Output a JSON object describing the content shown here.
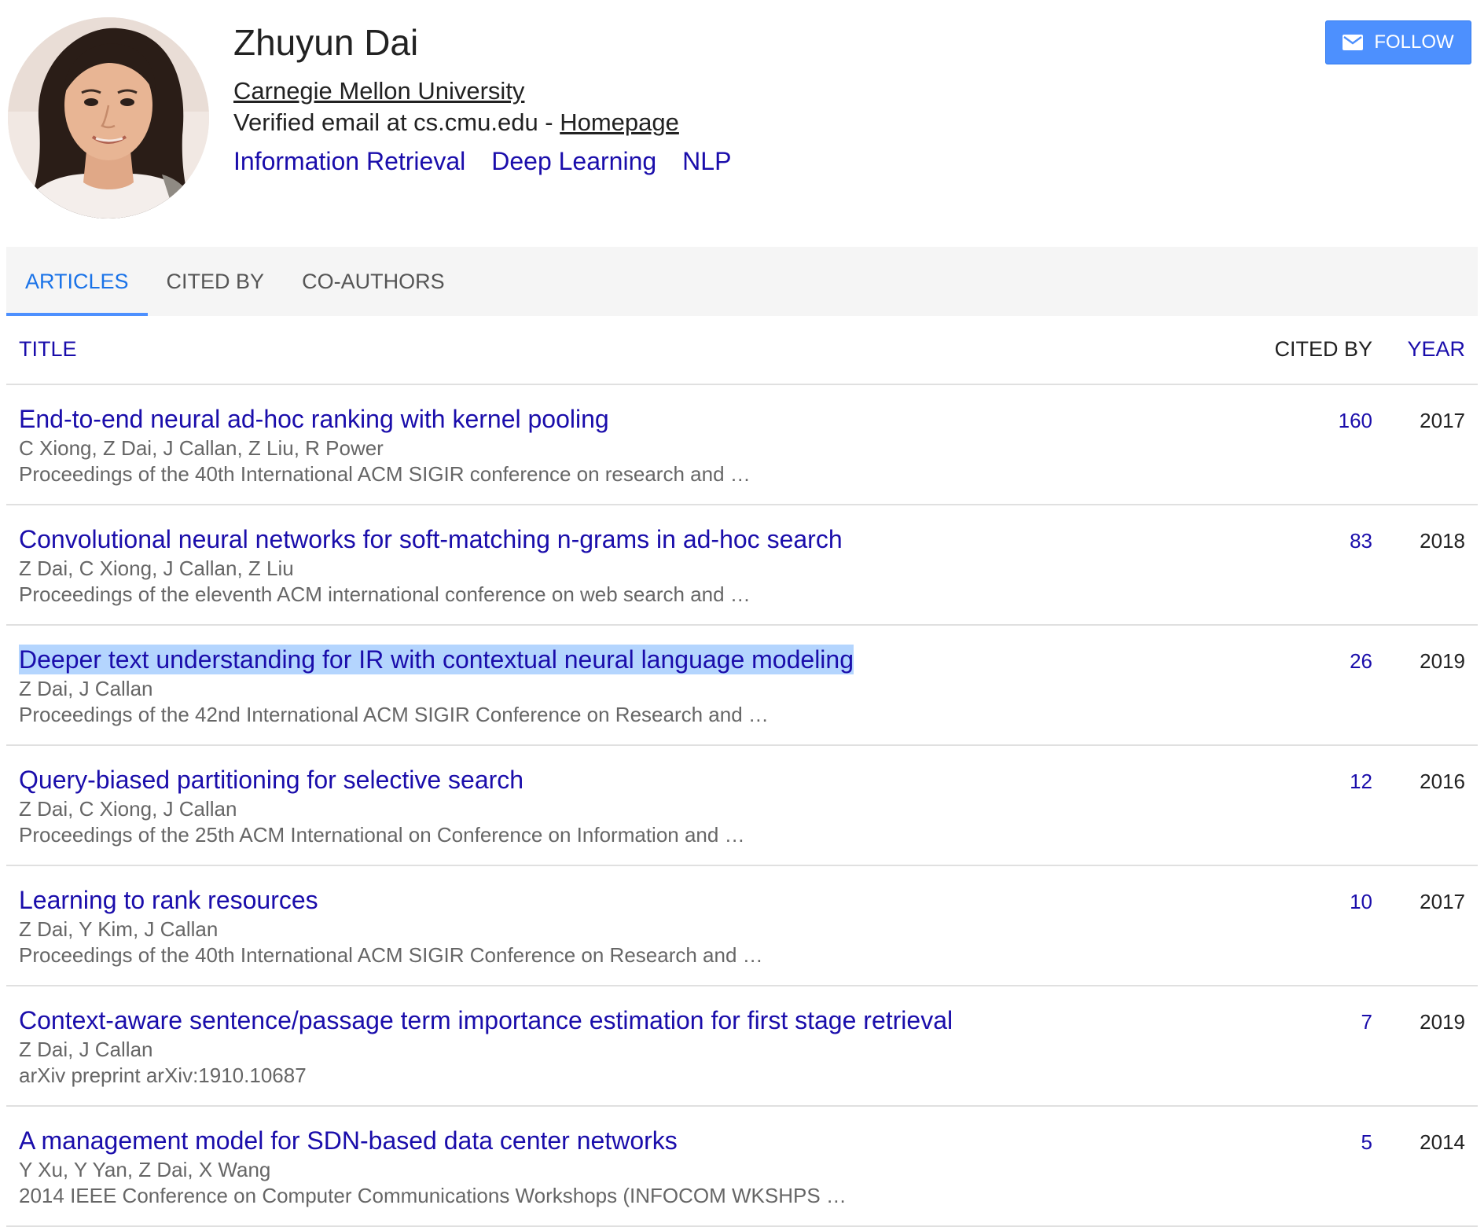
{
  "profile": {
    "name": "Zhuyun Dai",
    "affiliation": "Carnegie Mellon University",
    "email_text": "Verified email at cs.cmu.edu - ",
    "homepage_label": "Homepage",
    "interests": [
      "Information Retrieval",
      "Deep Learning",
      "NLP"
    ],
    "follow_label": "FOLLOW",
    "follow_icon": "envelope-icon",
    "accent_color": "#4d90fe"
  },
  "tabs": [
    {
      "label": "ARTICLES",
      "active": true
    },
    {
      "label": "CITED BY",
      "active": false
    },
    {
      "label": "CO-AUTHORS",
      "active": false
    }
  ],
  "table": {
    "headers": {
      "title": "TITLE",
      "cited_by": "CITED BY",
      "year": "YEAR"
    },
    "rows": [
      {
        "title": "End-to-end neural ad-hoc ranking with kernel pooling",
        "authors": "C Xiong, Z Dai, J Callan, Z Liu, R Power",
        "venue": "Proceedings of the 40th International ACM SIGIR conference on research and …",
        "cited_by": "160",
        "year": "2017"
      },
      {
        "title": "Convolutional neural networks for soft-matching n-grams in ad-hoc search",
        "authors": "Z Dai, C Xiong, J Callan, Z Liu",
        "venue": "Proceedings of the eleventh ACM international conference on web search and …",
        "cited_by": "83",
        "year": "2018"
      },
      {
        "title": "Deeper text understanding for IR with contextual neural language modeling",
        "authors": "Z Dai, J Callan",
        "venue": "Proceedings of the 42nd International ACM SIGIR Conference on Research and …",
        "cited_by": "26",
        "year": "2019",
        "selected": true
      },
      {
        "title": "Query-biased partitioning for selective search",
        "authors": "Z Dai, C Xiong, J Callan",
        "venue": "Proceedings of the 25th ACM International on Conference on Information and …",
        "cited_by": "12",
        "year": "2016"
      },
      {
        "title": "Learning to rank resources",
        "authors": "Z Dai, Y Kim, J Callan",
        "venue": "Proceedings of the 40th International ACM SIGIR Conference on Research and …",
        "cited_by": "10",
        "year": "2017"
      },
      {
        "title": "Context-aware sentence/passage term importance estimation for first stage retrieval",
        "authors": "Z Dai, J Callan",
        "venue": "arXiv preprint arXiv:1910.10687",
        "cited_by": "7",
        "year": "2019"
      },
      {
        "title": "A management model for SDN-based data center networks",
        "authors": "Y Xu, Y Yan, Z Dai, X Wang",
        "venue": "2014 IEEE Conference on Computer Communications Workshops (INFOCOM WKSHPS …",
        "cited_by": "5",
        "year": "2014"
      }
    ]
  }
}
